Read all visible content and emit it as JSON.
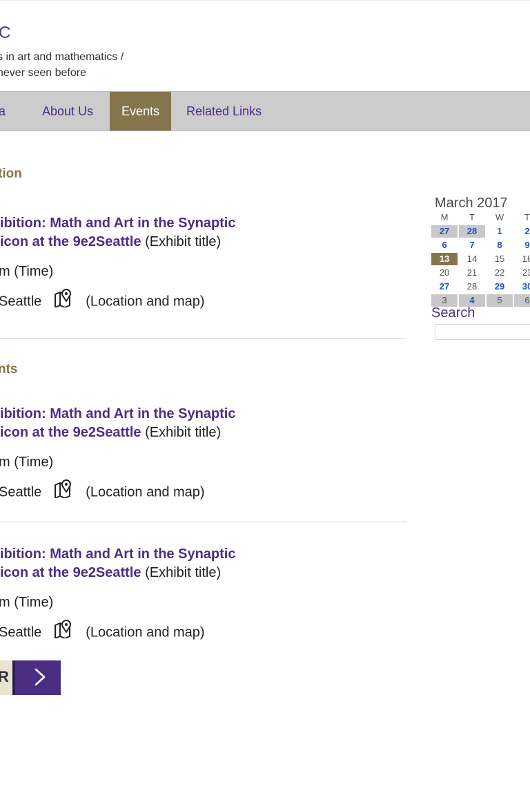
{
  "header": {
    "site_title": "C",
    "tagline_line1": "s in art and mathematics /",
    "tagline_line2": "never seen before"
  },
  "nav": {
    "items": [
      {
        "label": "ia"
      },
      {
        "label": "About Us"
      },
      {
        "label": "Events",
        "active": true
      },
      {
        "label": "Related Links"
      }
    ]
  },
  "sections": {
    "current_heading": "tion",
    "upcoming_heading": "nts"
  },
  "events": [
    {
      "title_line1": "ibition: Math and Art in the Synaptic",
      "title_line2_link": "icon at the 9e2Seattle",
      "title_suffix": " (Exhibit title)",
      "time": "m (Time)",
      "location": "Seattle",
      "location_suffix": "(Location and map)",
      "map_icon": "map-pin-icon"
    },
    {
      "title_line1": "ibition: Math and Art in the Synaptic",
      "title_line2_link": "icon at the 9e2Seattle",
      "title_suffix": " (Exhibit title)",
      "time": "m (Time)",
      "location": "Seattle",
      "location_suffix": "(Location and map)",
      "map_icon": "map-pin-icon"
    },
    {
      "title_line1": "ibition: Math and Art in the Synaptic",
      "title_line2_link": "icon at the 9e2Seattle",
      "title_suffix": " (Exhibit title)",
      "time": "m (Time)",
      "location": "Seattle",
      "location_suffix": "(Location and map)",
      "map_icon": "map-pin-icon"
    }
  ],
  "pager": {
    "prev_label": "R",
    "next_icon": "chevron-right-icon"
  },
  "calendar": {
    "title": "March 2017",
    "weekdays": [
      "M",
      "T",
      "W",
      "T"
    ],
    "weeks": [
      [
        "27",
        "28",
        "1",
        "2"
      ],
      [
        "6",
        "7",
        "8",
        "9"
      ],
      [
        "13",
        "14",
        "15",
        "16"
      ],
      [
        "20",
        "21",
        "22",
        "23"
      ],
      [
        "27",
        "28",
        "29",
        "30"
      ],
      [
        "3",
        "4",
        "5",
        "6"
      ]
    ]
  },
  "search": {
    "label": "Search",
    "value": ""
  },
  "colors": {
    "purple": "#4b2e83",
    "gold": "#85754d",
    "nav_bg": "#cdcccc",
    "calendar_link": "#1f50c8"
  }
}
